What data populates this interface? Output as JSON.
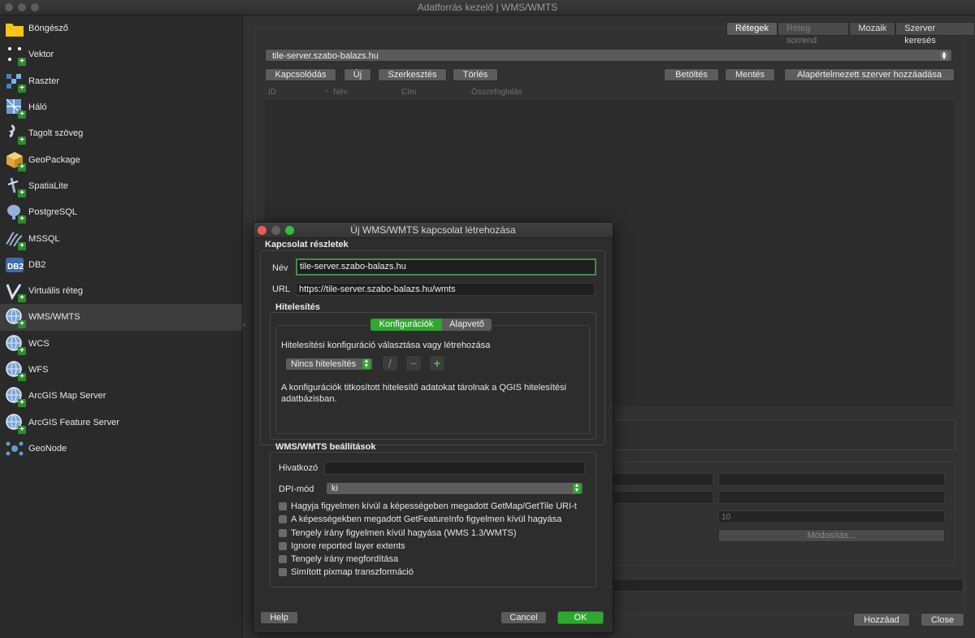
{
  "window": {
    "title": "Adatforrás kezelő | WMS/WMTS"
  },
  "sidebar": {
    "items": [
      {
        "label": "Böngésző",
        "icon": "folder-icon"
      },
      {
        "label": "Vektor",
        "icon": "vector-layer-icon"
      },
      {
        "label": "Raszter",
        "icon": "raster-layer-icon"
      },
      {
        "label": "Háló",
        "icon": "mesh-layer-icon"
      },
      {
        "label": "Tagolt szöveg",
        "icon": "delimited-text-icon"
      },
      {
        "label": "GeoPackage",
        "icon": "geopackage-icon"
      },
      {
        "label": "SpatiaLite",
        "icon": "spatialite-icon"
      },
      {
        "label": "PostgreSQL",
        "icon": "postgresql-icon"
      },
      {
        "label": "MSSQL",
        "icon": "mssql-icon"
      },
      {
        "label": "DB2",
        "icon": "db2-icon"
      },
      {
        "label": "Virtuális réteg",
        "icon": "virtual-layer-icon"
      },
      {
        "label": "WMS/WMTS",
        "icon": "wms-globe-icon",
        "selected": true
      },
      {
        "label": "WCS",
        "icon": "wcs-globe-icon"
      },
      {
        "label": "WFS",
        "icon": "wfs-globe-icon"
      },
      {
        "label": "ArcGIS Map Server",
        "icon": "arcgis-map-icon"
      },
      {
        "label": "ArcGIS Feature Server",
        "icon": "arcgis-feature-icon"
      },
      {
        "label": "GeoNode",
        "icon": "geonode-icon"
      }
    ]
  },
  "main": {
    "tabs": [
      "Rétegek",
      "Réteg sorrend",
      "Mozaik",
      "Szerver keresés"
    ],
    "server_combo": "tile-server.szabo-balazs.hu",
    "buttons": {
      "connect": "Kapcsolódás",
      "new": "Új",
      "edit": "Szerkesztés",
      "delete": "Törlés",
      "load": "Betöltés",
      "save": "Mentés",
      "add_default": "Alapértelmezett szerver hozzáadása"
    },
    "table_headers": [
      "ID",
      "Név",
      "Cím",
      "Összefoglalás"
    ],
    "tile_size_value": "10",
    "modify_button": "Módosítás...",
    "add_button": "Hozzáad",
    "close_button": "Close"
  },
  "dialog": {
    "title": "Új WMS/WMTS kapcsolat létrehozása",
    "connection_group": "Kapcsolat részletek",
    "name_label": "Név",
    "name_value": "tile-server.szabo-balazs.hu",
    "url_label": "URL",
    "url_value": "https://tile-server.szabo-balazs.hu/wmts",
    "auth_group": "Hitelesítés",
    "auth_tabs": [
      "Konfigurációk",
      "Alapvető"
    ],
    "auth_prompt": "Hitelesítési konfiguráció választása vagy létrehozása",
    "auth_select": "Nincs hitelesítés",
    "auth_note_1": "A konfigurációk titkosított hitelesítő adatokat tárolnak a QGIS hitelesítési",
    "auth_note_2": "adatbázisban.",
    "settings_group": "WMS/WMTS beállítások",
    "referer_label": "Hivatkozó",
    "dpi_label": "DPI-mód",
    "dpi_value": "ki",
    "checkboxes": [
      "Hagyja figyelmen kívül a képességeben megadott GetMap/GetTile URI-t",
      "A képességekben megadott GetFeatureInfo figyelmen kívül hagyása",
      "Tengely irány figyelmen kívül hagyása (WMS 1.3/WMTS)",
      "Ignore reported layer extents",
      "Tengely irány megfordítása",
      "Simított pixmap transzformáció"
    ],
    "help_button": "Help",
    "cancel_button": "Cancel",
    "ok_button": "OK"
  },
  "colors": {
    "accent_green": "#2fa82f",
    "focus_border": "#4a8a4a"
  }
}
